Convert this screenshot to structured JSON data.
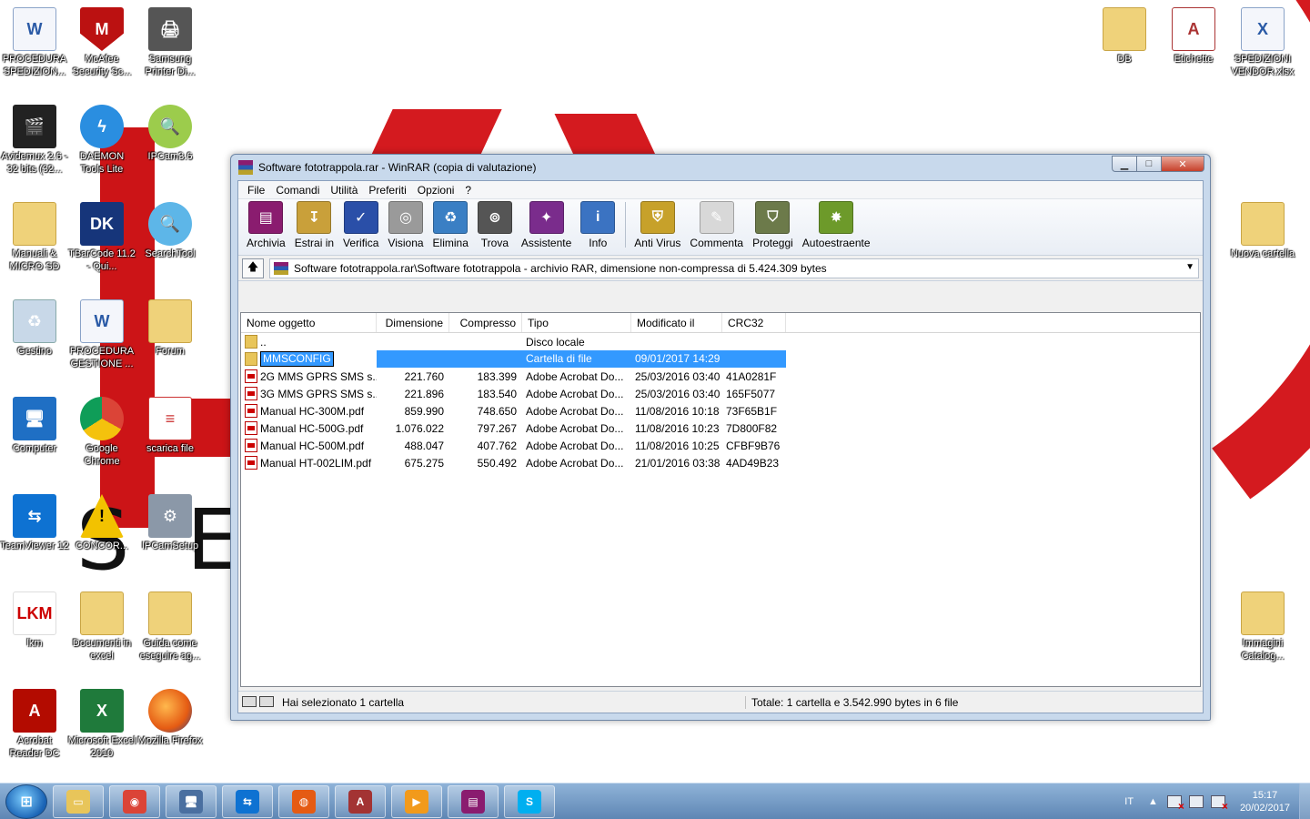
{
  "desktop": {
    "icons_left": [
      {
        "label": "PROCEDURA SPEDIZION...",
        "icon": "word-doc-icon",
        "glyph": "W"
      },
      {
        "label": "McAfee Security Sc...",
        "icon": "mcafee-shield-icon",
        "glyph": "M"
      },
      {
        "label": "Samsung Printer Di...",
        "icon": "printer-icon",
        "glyph": "🖨"
      },
      {
        "label": "Avidemux 2.6 - 32 bits (32...",
        "icon": "clapperboard-icon",
        "glyph": "🎬"
      },
      {
        "label": "DAEMON Tools Lite",
        "icon": "lightning-icon",
        "glyph": "ϟ"
      },
      {
        "label": "IPCam3.6",
        "icon": "magnifier-icon",
        "glyph": "🔍"
      },
      {
        "label": "Manuali & MICRO SD",
        "icon": "folder-icon",
        "glyph": ""
      },
      {
        "label": "TBarCode 11.2 - Qui...",
        "icon": "qr-code-icon",
        "glyph": "DK"
      },
      {
        "label": "SearchTool",
        "icon": "search-camera-icon",
        "glyph": "🔍"
      },
      {
        "label": "Gestino",
        "icon": "recycle-bin-icon",
        "glyph": "♻"
      },
      {
        "label": "PROCEDURA GESTIONE ...",
        "icon": "word-doc-icon",
        "glyph": "W"
      },
      {
        "label": "Forum",
        "icon": "folder-icon",
        "glyph": ""
      },
      {
        "label": "Computer",
        "icon": "computer-icon",
        "glyph": "🖥"
      },
      {
        "label": "Google Chrome",
        "icon": "chrome-icon",
        "glyph": ""
      },
      {
        "label": "scarica file",
        "icon": "document-icon",
        "glyph": "≡"
      },
      {
        "label": "TeamViewer 12",
        "icon": "teamviewer-icon",
        "glyph": "⇆"
      },
      {
        "label": "CONCOR...",
        "icon": "warning-icon",
        "glyph": "!"
      },
      {
        "label": "IPCamSetup",
        "icon": "setup-icon",
        "glyph": "⚙"
      },
      {
        "label": "lkm",
        "icon": "lkm-logo-icon",
        "glyph": "LKM"
      },
      {
        "label": "Documenti in excel",
        "icon": "folder-icon",
        "glyph": ""
      },
      {
        "label": "Guida come eseguire ag...",
        "icon": "folder-icon",
        "glyph": ""
      },
      {
        "label": "Acrobat Reader DC",
        "icon": "acrobat-icon",
        "glyph": "A"
      },
      {
        "label": "Microsoft Excel 2010",
        "icon": "excel-icon",
        "glyph": "X"
      },
      {
        "label": "Mozilla Firefox",
        "icon": "firefox-icon",
        "glyph": ""
      }
    ],
    "icons_right": [
      {
        "label": "DB",
        "icon": "folder-icon",
        "glyph": ""
      },
      {
        "label": "Etichette",
        "icon": "access-icon",
        "glyph": "A"
      },
      {
        "label": "SPEDIZIONI VENDOR.xlsx",
        "icon": "excel-file-icon",
        "glyph": "X"
      },
      {
        "label": "Nuova cartella",
        "icon": "folder-icon",
        "glyph": ""
      },
      {
        "label": "Immagini Catalog...",
        "icon": "folder-icon",
        "glyph": ""
      }
    ],
    "wallpaper_letters": [
      "S",
      "E"
    ]
  },
  "window": {
    "title": "Software fototrappola.rar - WinRAR (copia di valutazione)",
    "buttons": {
      "minimize": "▁",
      "maximize": "□",
      "close": "✕"
    },
    "menu": [
      "File",
      "Comandi",
      "Utilità",
      "Preferiti",
      "Opzioni",
      "?"
    ],
    "toolbar": [
      {
        "label": "Archivia",
        "icon": "archive-books-icon",
        "color": "#8a1c6f",
        "glyph": "▤"
      },
      {
        "label": "Estrai in",
        "icon": "extract-folder-icon",
        "color": "#c9a03a",
        "glyph": "↧"
      },
      {
        "label": "Verifica",
        "icon": "test-book-icon",
        "color": "#2a4fa8",
        "glyph": "✓"
      },
      {
        "label": "Visiona",
        "icon": "view-glasses-icon",
        "color": "#9a9a9a",
        "glyph": "◎"
      },
      {
        "label": "Elimina",
        "icon": "delete-bin-icon",
        "color": "#3a7fc4",
        "glyph": "♻"
      },
      {
        "label": "Trova",
        "icon": "find-binoculars-icon",
        "color": "#555555",
        "glyph": "⊚"
      },
      {
        "label": "Assistente",
        "icon": "wizard-icon",
        "color": "#7a2c8c",
        "glyph": "✦"
      },
      {
        "label": "Info",
        "icon": "info-icon",
        "color": "#3b73c2",
        "glyph": "i"
      },
      {
        "label": "Anti Virus",
        "icon": "antivirus-icon",
        "color": "#c7a12a",
        "glyph": "⛨"
      },
      {
        "label": "Commenta",
        "icon": "comment-icon",
        "color": "#d8d8d8",
        "glyph": "✎"
      },
      {
        "label": "Proteggi",
        "icon": "protect-shield-icon",
        "color": "#6c7a4a",
        "glyph": "⛉"
      },
      {
        "label": "Autoestraente",
        "icon": "sfx-icon",
        "color": "#6d9a2a",
        "glyph": "✸"
      }
    ],
    "path": "Software fototrappola.rar\\Software fototrappola - archivio RAR, dimensione non-compressa di 5.424.309 bytes",
    "columns": [
      "Nome oggetto",
      "Dimensione",
      "Compresso",
      "Tipo",
      "Modificato il",
      "CRC32"
    ],
    "rows": [
      {
        "name": "..",
        "size": "",
        "packed": "",
        "type": "Disco locale",
        "modified": "",
        "crc": "",
        "kind": "folder"
      },
      {
        "name": "MMSCONFIG",
        "size": "",
        "packed": "",
        "type": "Cartella di file",
        "modified": "09/01/2017 14:29",
        "crc": "",
        "kind": "folder",
        "selected": true
      },
      {
        "name": "2G MMS GPRS SMS s...",
        "size": "221.760",
        "packed": "183.399",
        "type": "Adobe Acrobat Do...",
        "modified": "25/03/2016 03:40",
        "crc": "41A0281F",
        "kind": "pdf"
      },
      {
        "name": "3G MMS GPRS SMS s...",
        "size": "221.896",
        "packed": "183.540",
        "type": "Adobe Acrobat Do...",
        "modified": "25/03/2016 03:40",
        "crc": "165F5077",
        "kind": "pdf"
      },
      {
        "name": "Manual HC-300M.pdf",
        "size": "859.990",
        "packed": "748.650",
        "type": "Adobe Acrobat Do...",
        "modified": "11/08/2016 10:18",
        "crc": "73F65B1F",
        "kind": "pdf"
      },
      {
        "name": "Manual HC-500G.pdf",
        "size": "1.076.022",
        "packed": "797.267",
        "type": "Adobe Acrobat Do...",
        "modified": "11/08/2016 10:23",
        "crc": "7D800F82",
        "kind": "pdf"
      },
      {
        "name": "Manual HC-500M.pdf",
        "size": "488.047",
        "packed": "407.762",
        "type": "Adobe Acrobat Do...",
        "modified": "11/08/2016 10:25",
        "crc": "CFBF9B76",
        "kind": "pdf"
      },
      {
        "name": "Manual HT-002LIM.pdf",
        "size": "675.275",
        "packed": "550.492",
        "type": "Adobe Acrobat Do...",
        "modified": "21/01/2016 03:38",
        "crc": "4AD49B23",
        "kind": "pdf"
      }
    ],
    "status_left": "Hai selezionato 1 cartella",
    "status_right": "Totale: 1 cartella e 3.542.990 bytes in 6 file"
  },
  "taskbar": {
    "items": [
      {
        "icon": "explorer-folder-icon",
        "color": "#e8c55a",
        "glyph": "▭"
      },
      {
        "icon": "chrome-icon",
        "color": "#db4437",
        "glyph": "◉"
      },
      {
        "icon": "network-computer-icon",
        "color": "#4a6fa0",
        "glyph": "🖥"
      },
      {
        "icon": "teamviewer-icon",
        "color": "#0e72d2",
        "glyph": "⇆"
      },
      {
        "icon": "firefox-icon",
        "color": "#e55b13",
        "glyph": "◍"
      },
      {
        "icon": "access-icon",
        "color": "#a33333",
        "glyph": "A"
      },
      {
        "icon": "media-player-icon",
        "color": "#f29a1b",
        "glyph": "▶"
      },
      {
        "icon": "winrar-icon",
        "color": "#8a1c6f",
        "glyph": "▤"
      },
      {
        "icon": "skype-icon",
        "color": "#00aff0",
        "glyph": "S"
      }
    ],
    "language": "IT",
    "time": "15:17",
    "date": "20/02/2017"
  }
}
